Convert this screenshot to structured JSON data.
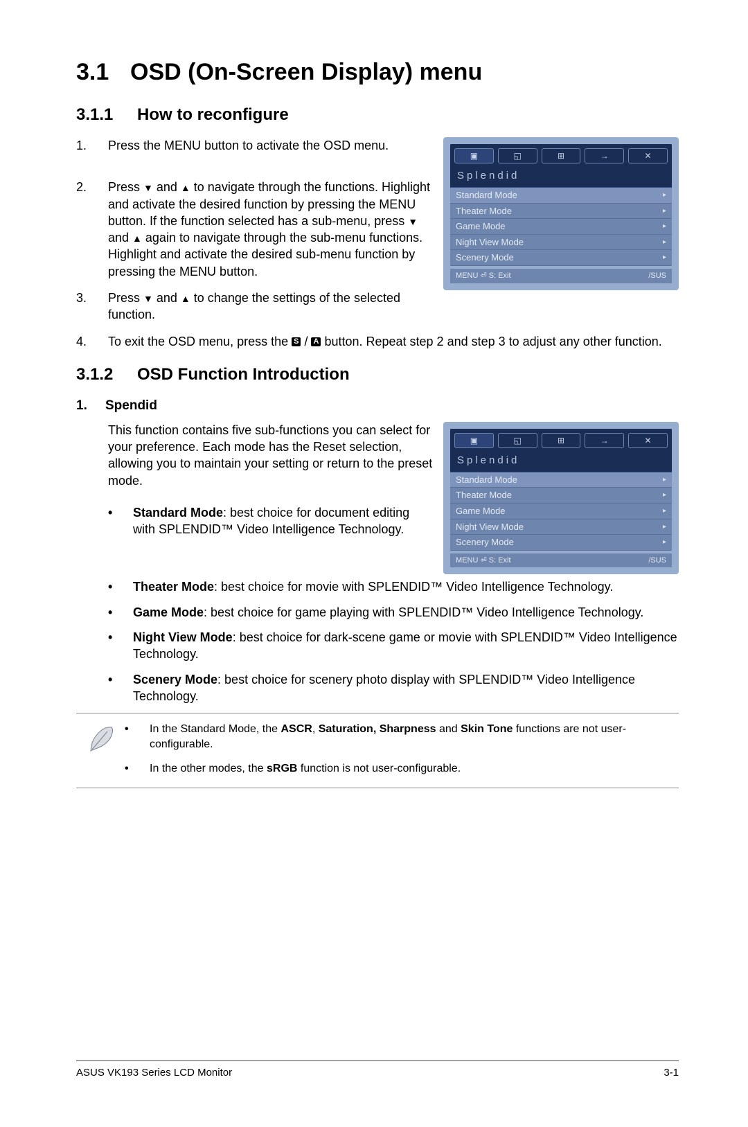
{
  "section": {
    "num": "3.1",
    "title": "OSD (On-Screen Display) menu"
  },
  "sub1": {
    "num": "3.1.1",
    "title": "How to reconfigure"
  },
  "steps": {
    "s1": {
      "n": "1.",
      "t": "Press the MENU button to activate the OSD menu."
    },
    "s2": {
      "n": "2.",
      "pre": "Press ",
      "mid1": " and ",
      "mid2": " to navigate through the functions. Highlight and activate the desired function by pressing the MENU button. If the function selected has a sub-menu, press ",
      "mid3": " and ",
      "post": " again to navigate through the sub-menu functions. Highlight and activate the desired sub-menu function by pressing the MENU button."
    },
    "s3": {
      "n": "3.",
      "pre": "Press ",
      "mid": " and ",
      "post": " to change the settings of the selected function."
    },
    "s4": {
      "n": "4.",
      "pre": "To exit the OSD menu, press the ",
      "post": " button. Repeat step 2 and step 3 to adjust any other function.",
      "sa_s": "S",
      "sa_slash": " / ",
      "sa_a": "A"
    }
  },
  "sub2": {
    "num": "3.1.2",
    "title": "OSD Function Introduction"
  },
  "func1": {
    "n": "1.",
    "name": "Spendid",
    "desc": "This function contains five sub-functions you can select for your preference. Each mode has the Reset selection, allowing you to maintain your setting or return to the preset mode.",
    "modes": {
      "m1": {
        "label": "Standard Mode",
        "rest": ": best choice for document editing with SPLENDID™ Video Intelligence Technology."
      },
      "m2": {
        "label": "Theater Mode",
        "rest": ": best choice for movie with SPLENDID™ Video Intelligence Technology."
      },
      "m3": {
        "label": "Game Mode",
        "rest": ": best choice for game playing with SPLENDID™ Video Intelligence Technology."
      },
      "m4": {
        "label": "Night View Mode",
        "rest": ": best choice for dark-scene game or movie with SPLENDID™ Video Intelligence Technology."
      },
      "m5": {
        "label": "Scenery Mode",
        "rest": ": best choice for scenery photo display with SPLENDID™ Video Intelligence Technology."
      }
    }
  },
  "notes": {
    "n1": {
      "pre": "In the Standard Mode, the ",
      "b1": "ASCR",
      "mid1": ", ",
      "b2": "Saturation, Sharpness",
      "mid2": " and ",
      "b3": "Skin Tone",
      "post": " functions are not user-configurable."
    },
    "n2": {
      "pre": "In the other modes, the ",
      "b1": "sRGB",
      "post": " function is not user-configurable."
    }
  },
  "osd": {
    "title": "Splendid",
    "items": {
      "i0": "Standard Mode",
      "i1": "Theater Mode",
      "i2": "Game Mode",
      "i3": "Night View Mode",
      "i4": "Scenery Mode"
    },
    "foot_left": "MENU  ⏎   S: Exit",
    "foot_right": "/SUS",
    "tab_glyphs": {
      "t0": "▣",
      "t1": "◱",
      "t2": "⊞",
      "t3": "→",
      "t4": "✕"
    }
  },
  "footer": {
    "left": "ASUS VK193 Series LCD Monitor",
    "right": "3-1"
  }
}
